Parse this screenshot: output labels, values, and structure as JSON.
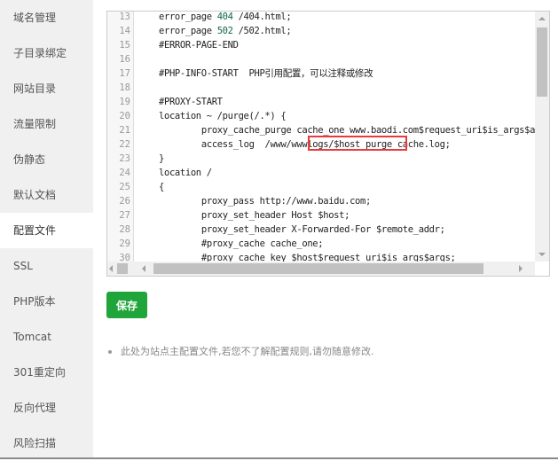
{
  "sidebar": {
    "items": [
      {
        "label": "域名管理",
        "active": false
      },
      {
        "label": "子目录绑定",
        "active": false
      },
      {
        "label": "网站目录",
        "active": false
      },
      {
        "label": "流量限制",
        "active": false
      },
      {
        "label": "伪静态",
        "active": false
      },
      {
        "label": "默认文档",
        "active": false
      },
      {
        "label": "配置文件",
        "active": true
      },
      {
        "label": "SSL",
        "active": false
      },
      {
        "label": "PHP版本",
        "active": false
      },
      {
        "label": "Tomcat",
        "active": false
      },
      {
        "label": "301重定向",
        "active": false
      },
      {
        "label": "反向代理",
        "active": false
      },
      {
        "label": "风险扫描",
        "active": false
      }
    ]
  },
  "editor": {
    "lines": [
      {
        "n": "13",
        "code": "    error_page 404 /404.html;"
      },
      {
        "n": "14",
        "code": "    error_page 502 /502.html;"
      },
      {
        "n": "15",
        "code": "    #ERROR-PAGE-END"
      },
      {
        "n": "16",
        "code": ""
      },
      {
        "n": "17",
        "code": "    #PHP-INFO-START  PHP引用配置，可以注释或修改"
      },
      {
        "n": "18",
        "code": ""
      },
      {
        "n": "19",
        "code": "    #PROXY-START"
      },
      {
        "n": "20",
        "code": "    location ~ /purge(/.*) {"
      },
      {
        "n": "21",
        "code": "        proxy_cache_purge cache_one www.baodi.com$request_uri$is_args$args;"
      },
      {
        "n": "22",
        "code": "        access_log  /www/wwwlogs/$host_purge_cache.log;"
      },
      {
        "n": "23",
        "code": "    }"
      },
      {
        "n": "24",
        "code": "    location /"
      },
      {
        "n": "25",
        "code": "    {"
      },
      {
        "n": "26",
        "code": "        proxy_pass http://www.baidu.com;"
      },
      {
        "n": "27",
        "code": "        proxy_set_header Host $host;"
      },
      {
        "n": "28",
        "code": "        proxy_set_header X-Forwarded-For $remote_addr;"
      },
      {
        "n": "29",
        "code": "        #proxy_cache cache_one;"
      },
      {
        "n": "30",
        "code": "        #proxy_cache_key $host$request_uri$is_args$args;"
      }
    ],
    "highlighted_text": "$host_purge_cache.",
    "highlight_color": "#e83a3a"
  },
  "actions": {
    "save_label": "保存",
    "save_color": "#20a53a"
  },
  "tips": [
    "此处为站点主配置文件,若您不了解配置规则,请勿随意修改."
  ]
}
